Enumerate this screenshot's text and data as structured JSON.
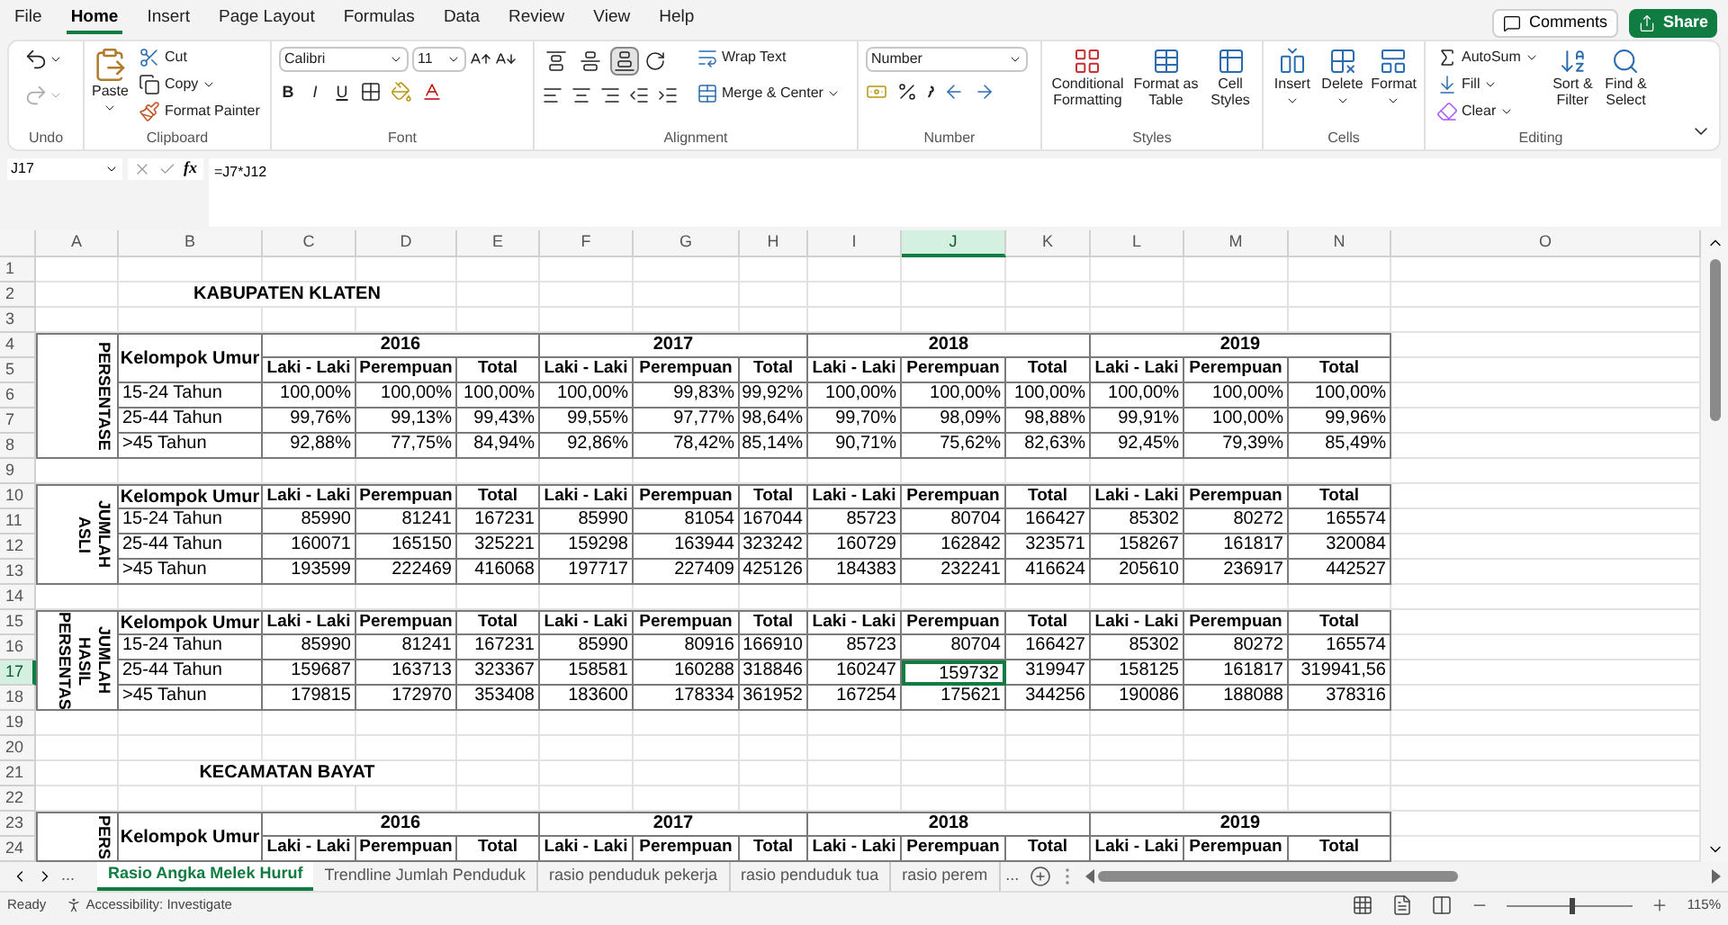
{
  "menu_tabs": [
    {
      "label": "File",
      "selected": false
    },
    {
      "label": "Home",
      "selected": true
    },
    {
      "label": "Insert",
      "selected": false
    },
    {
      "label": "Page Layout",
      "selected": false
    },
    {
      "label": "Formulas",
      "selected": false
    },
    {
      "label": "Data",
      "selected": false
    },
    {
      "label": "Review",
      "selected": false
    },
    {
      "label": "View",
      "selected": false
    },
    {
      "label": "Help",
      "selected": false
    }
  ],
  "top_buttons": {
    "comments": "Comments",
    "share": "Share"
  },
  "ribbon": {
    "undo": {
      "label": "Undo"
    },
    "clipboard": {
      "label": "Clipboard",
      "paste": "Paste",
      "cut": "Cut",
      "copy": "Copy",
      "format_painter": "Format Painter"
    },
    "font": {
      "label": "Font",
      "family": "Calibri",
      "size": "11",
      "style_buttons": [
        "B",
        "I",
        "U"
      ]
    },
    "alignment": {
      "label": "Alignment",
      "valign_selected": [
        false,
        false,
        true
      ],
      "wrap_text": "Wrap Text",
      "merge_center": "Merge & Center"
    },
    "number": {
      "label": "Number",
      "format": "Number"
    },
    "styles": {
      "label": "Styles",
      "buttons": [
        "Conditional Formatting",
        "Format as Table",
        "Cell Styles"
      ]
    },
    "cells": {
      "label": "Cells",
      "buttons": [
        "Insert",
        "Delete",
        "Format"
      ]
    },
    "editing": {
      "label": "Editing",
      "autosum": "AutoSum",
      "fill": "Fill",
      "clear": "Clear",
      "buttons": [
        "Sort & Filter",
        "Find & Select"
      ]
    }
  },
  "formula_bar": {
    "name_box": "J17",
    "fx": "fx",
    "formula": "=J7*J12"
  },
  "columns": [
    {
      "label": "A",
      "selected": false
    },
    {
      "label": "B",
      "selected": false
    },
    {
      "label": "C",
      "selected": false
    },
    {
      "label": "D",
      "selected": false
    },
    {
      "label": "E",
      "selected": false
    },
    {
      "label": "F",
      "selected": false
    },
    {
      "label": "G",
      "selected": false
    },
    {
      "label": "H",
      "selected": false
    },
    {
      "label": "I",
      "selected": false
    },
    {
      "label": "J",
      "selected": true
    },
    {
      "label": "K",
      "selected": false
    },
    {
      "label": "L",
      "selected": false
    },
    {
      "label": "M",
      "selected": false
    },
    {
      "label": "N",
      "selected": false
    },
    {
      "label": "O",
      "selected": false
    }
  ],
  "row_numbers": [
    {
      "label": "1",
      "selected": false
    },
    {
      "label": "2",
      "selected": false
    },
    {
      "label": "3",
      "selected": false
    },
    {
      "label": "4",
      "selected": false
    },
    {
      "label": "5",
      "selected": false
    },
    {
      "label": "6",
      "selected": false
    },
    {
      "label": "7",
      "selected": false
    },
    {
      "label": "8",
      "selected": false
    },
    {
      "label": "9",
      "selected": false
    },
    {
      "label": "10",
      "selected": false
    },
    {
      "label": "11",
      "selected": false
    },
    {
      "label": "12",
      "selected": false
    },
    {
      "label": "13",
      "selected": false
    },
    {
      "label": "14",
      "selected": false
    },
    {
      "label": "15",
      "selected": false
    },
    {
      "label": "16",
      "selected": false
    },
    {
      "label": "17",
      "selected": true
    },
    {
      "label": "18",
      "selected": false
    },
    {
      "label": "19",
      "selected": false
    },
    {
      "label": "20",
      "selected": false
    },
    {
      "label": "21",
      "selected": false
    },
    {
      "label": "22",
      "selected": false
    },
    {
      "label": "23",
      "selected": false
    },
    {
      "label": "24",
      "selected": false
    }
  ],
  "sections": [
    {
      "title": "KABUPATEN KLATEN",
      "blocks": [
        {
          "side_label": "PERSENTASE",
          "group_header": "Kelompok Umur",
          "years": [
            "2016",
            "2017",
            "2018",
            "2019"
          ],
          "header": [
            "Laki - Laki",
            "Perempuan",
            "Total",
            "Laki - Laki",
            "Perempuan",
            "Total",
            "Laki - Laki",
            "Perempuan",
            "Total",
            "Laki - Laki",
            "Perempuan",
            "Total"
          ],
          "rows": [
            {
              "label": "15-24 Tahun",
              "values": [
                "100,00%",
                "100,00%",
                "100,00%",
                "100,00%",
                "99,83%",
                "99,92%",
                "100,00%",
                "100,00%",
                "100,00%",
                "100,00%",
                "100,00%",
                "100,00%"
              ]
            },
            {
              "label": "25-44 Tahun",
              "values": [
                "99,76%",
                "99,13%",
                "99,43%",
                "99,55%",
                "97,77%",
                "98,64%",
                "99,70%",
                "98,09%",
                "98,88%",
                "99,91%",
                "100,00%",
                "99,96%"
              ]
            },
            {
              "label": ">45 Tahun",
              "values": [
                "92,88%",
                "77,75%",
                "84,94%",
                "92,86%",
                "78,42%",
                "85,14%",
                "90,71%",
                "75,62%",
                "82,63%",
                "92,45%",
                "79,39%",
                "85,49%"
              ]
            }
          ]
        },
        {
          "side_label": "JUMLAH ASLI",
          "group_header": "Kelompok Umur",
          "header": [
            "Laki - Laki",
            "Perempuan",
            "Total",
            "Laki - Laki",
            "Perempuan",
            "Total",
            "Laki - Laki",
            "Perempuan",
            "Total",
            "Laki - Laki",
            "Perempuan",
            "Total"
          ],
          "rows": [
            {
              "label": "15-24 Tahun",
              "values": [
                "85990",
                "81241",
                "167231",
                "85990",
                "81054",
                "167044",
                "85723",
                "80704",
                "166427",
                "85302",
                "80272",
                "165574"
              ]
            },
            {
              "label": "25-44 Tahun",
              "values": [
                "160071",
                "165150",
                "325221",
                "159298",
                "163944",
                "323242",
                "160729",
                "162842",
                "323571",
                "158267",
                "161817",
                "320084"
              ]
            },
            {
              "label": ">45 Tahun",
              "values": [
                "193599",
                "222469",
                "416068",
                "197717",
                "227409",
                "425126",
                "184383",
                "232241",
                "416624",
                "205610",
                "236917",
                "442527"
              ]
            }
          ]
        },
        {
          "side_label": "JUMLAH HASIL PERSENTAS",
          "group_header": "Kelompok Umur",
          "header": [
            "Laki - Laki",
            "Perempuan",
            "Total",
            "Laki - Laki",
            "Perempuan",
            "Total",
            "Laki - Laki",
            "Perempuan",
            "Total",
            "Laki - Laki",
            "Perempuan",
            "Total"
          ],
          "rows": [
            {
              "label": "15-24 Tahun",
              "values": [
                "85990",
                "81241",
                "167231",
                "85990",
                "80916",
                "166910",
                "85723",
                "80704",
                "166427",
                "85302",
                "80272",
                "165574"
              ]
            },
            {
              "label": "25-44 Tahun",
              "values": [
                "159687",
                "163713",
                "323367",
                "158581",
                "160288",
                "318846",
                "160247",
                "159732",
                "319947",
                "158125",
                "161817",
                "319941,56"
              ]
            },
            {
              "label": ">45 Tahun",
              "values": [
                "179815",
                "172970",
                "353408",
                "183600",
                "178334",
                "361952",
                "167254",
                "175621",
                "344256",
                "190086",
                "188088",
                "378316"
              ]
            }
          ]
        }
      ]
    },
    {
      "title": "KECAMATAN BAYAT",
      "blocks": [
        {
          "side_label": "PERS",
          "group_header": "Kelompok Umur",
          "years": [
            "2016",
            "2017",
            "2018",
            "2019"
          ],
          "header": [
            "Laki - Laki",
            "Perempuan",
            "Total",
            "Laki - Laki",
            "Perempuan",
            "Total",
            "Laki - Laki",
            "Perempuan",
            "Total",
            "Laki - Laki",
            "Perempuan",
            "Total"
          ]
        }
      ]
    }
  ],
  "sheet_tabs": {
    "more": "...",
    "tabs": [
      {
        "label": "Rasio Angka Melek Huruf",
        "selected": true
      },
      {
        "label": "Trendline Jumlah Penduduk",
        "selected": false
      },
      {
        "label": "rasio penduduk pekerja",
        "selected": false
      },
      {
        "label": "rasio penduduk tua",
        "selected": false
      },
      {
        "label": "rasio perem",
        "selected": false
      }
    ],
    "more_right": "..."
  },
  "status_bar": {
    "ready": "Ready",
    "accessibility": "Accessibility: Investigate",
    "zoom": "115%",
    "zoom_slider": {
      "level": 0.5
    }
  }
}
